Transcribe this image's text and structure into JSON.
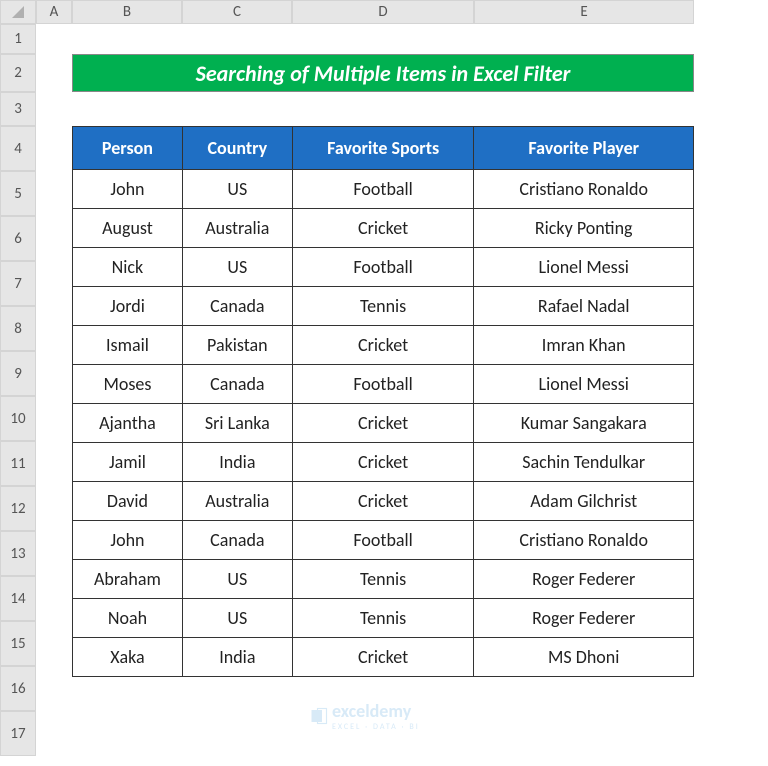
{
  "columns": [
    "A",
    "B",
    "C",
    "D",
    "E"
  ],
  "rows": [
    "1",
    "2",
    "3",
    "4",
    "5",
    "6",
    "7",
    "8",
    "9",
    "10",
    "11",
    "12",
    "13",
    "14",
    "15",
    "16",
    "17"
  ],
  "title": "Searching of Multiple Items in Excel Filter",
  "headers": {
    "person": "Person",
    "country": "Country",
    "sports": "Favorite Sports",
    "player": "Favorite Player"
  },
  "data": [
    {
      "person": "John",
      "country": "US",
      "sports": "Football",
      "player": "Cristiano Ronaldo"
    },
    {
      "person": "August",
      "country": "Australia",
      "sports": "Cricket",
      "player": "Ricky Ponting"
    },
    {
      "person": "Nick",
      "country": "US",
      "sports": "Football",
      "player": "Lionel Messi"
    },
    {
      "person": "Jordi",
      "country": "Canada",
      "sports": "Tennis",
      "player": "Rafael Nadal"
    },
    {
      "person": "Ismail",
      "country": "Pakistan",
      "sports": "Cricket",
      "player": "Imran Khan"
    },
    {
      "person": "Moses",
      "country": "Canada",
      "sports": "Football",
      "player": "Lionel Messi"
    },
    {
      "person": "Ajantha",
      "country": "Sri Lanka",
      "sports": "Cricket",
      "player": "Kumar Sangakara"
    },
    {
      "person": "Jamil",
      "country": "India",
      "sports": "Cricket",
      "player": "Sachin Tendulkar"
    },
    {
      "person": "David",
      "country": "Australia",
      "sports": "Cricket",
      "player": "Adam Gilchrist"
    },
    {
      "person": "John",
      "country": "Canada",
      "sports": "Football",
      "player": "Cristiano Ronaldo"
    },
    {
      "person": "Abraham",
      "country": "US",
      "sports": "Tennis",
      "player": "Roger Federer"
    },
    {
      "person": "Noah",
      "country": "US",
      "sports": "Tennis",
      "player": "Roger Federer"
    },
    {
      "person": "Xaka",
      "country": "India",
      "sports": "Cricket",
      "player": "MS Dhoni"
    }
  ],
  "watermark": {
    "brand": "exceldemy",
    "sub": "EXCEL · DATA · BI"
  }
}
